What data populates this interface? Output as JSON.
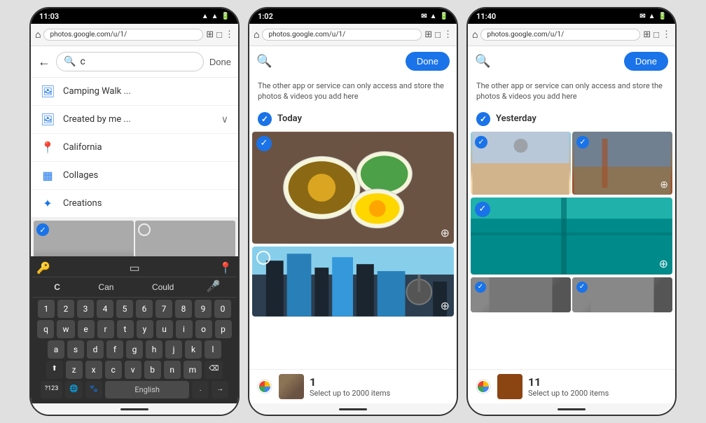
{
  "phone1": {
    "status": {
      "time": "11:03",
      "icons": "▲ ◼ ▲ ▲ 🔋"
    },
    "browser": {
      "url": "photos.google.com/u/1/",
      "icons": [
        "⊞",
        "□",
        "⋮"
      ]
    },
    "header": {
      "back_label": "←",
      "search_text": "c",
      "done_label": "Done"
    },
    "autocomplete": [
      {
        "icon": "🖼",
        "label": "Camping Walk ...",
        "expand": ""
      },
      {
        "icon": "🖼",
        "label": "Created by me ...",
        "expand": "∨"
      },
      {
        "icon": "📍",
        "label": "California",
        "expand": ""
      },
      {
        "icon": "□",
        "label": "Collages",
        "expand": ""
      },
      {
        "icon": "✦",
        "label": "Creations",
        "expand": ""
      }
    ],
    "keyboard": {
      "suggestions": [
        "C",
        "Can",
        "Could"
      ],
      "rows": [
        [
          "q",
          "w",
          "e",
          "r",
          "t",
          "y",
          "u",
          "i",
          "o",
          "p"
        ],
        [
          "a",
          "s",
          "d",
          "f",
          "g",
          "h",
          "j",
          "k",
          "l"
        ],
        [
          "z",
          "x",
          "c",
          "v",
          "b",
          "n",
          "m"
        ]
      ],
      "special": [
        "⬆",
        "?123",
        "🌐",
        "⎵ English ⎵",
        ".",
        "→"
      ],
      "language": "English"
    }
  },
  "phone2": {
    "status": {
      "time": "1:02",
      "icons": "▲ 🔋"
    },
    "browser": {
      "url": "photos.google.com/u/1/"
    },
    "header": {
      "done_label": "Done"
    },
    "info_text": "The other app or service can only access and store the photos & videos you add here",
    "section": "Today",
    "bottom": {
      "count": "1",
      "select_text": "Select up to 2000 items"
    }
  },
  "phone3": {
    "status": {
      "time": "11:40",
      "icons": "▲ 🔋"
    },
    "browser": {
      "url": "photos.google.com/u/1/"
    },
    "header": {
      "done_label": "Done"
    },
    "info_text": "The other app or service can only access and store the photos & videos you add here",
    "section": "Yesterday",
    "bottom": {
      "count": "11",
      "select_text": "Select up to 2000 items"
    }
  },
  "icons": {
    "check": "✓",
    "back": "←",
    "search": "🔍",
    "mic": "🎤",
    "zoom": "⊕",
    "globe": "🌐",
    "google_colors": [
      "#4285F4",
      "#EA4335",
      "#FBBC05",
      "#34A853"
    ]
  }
}
